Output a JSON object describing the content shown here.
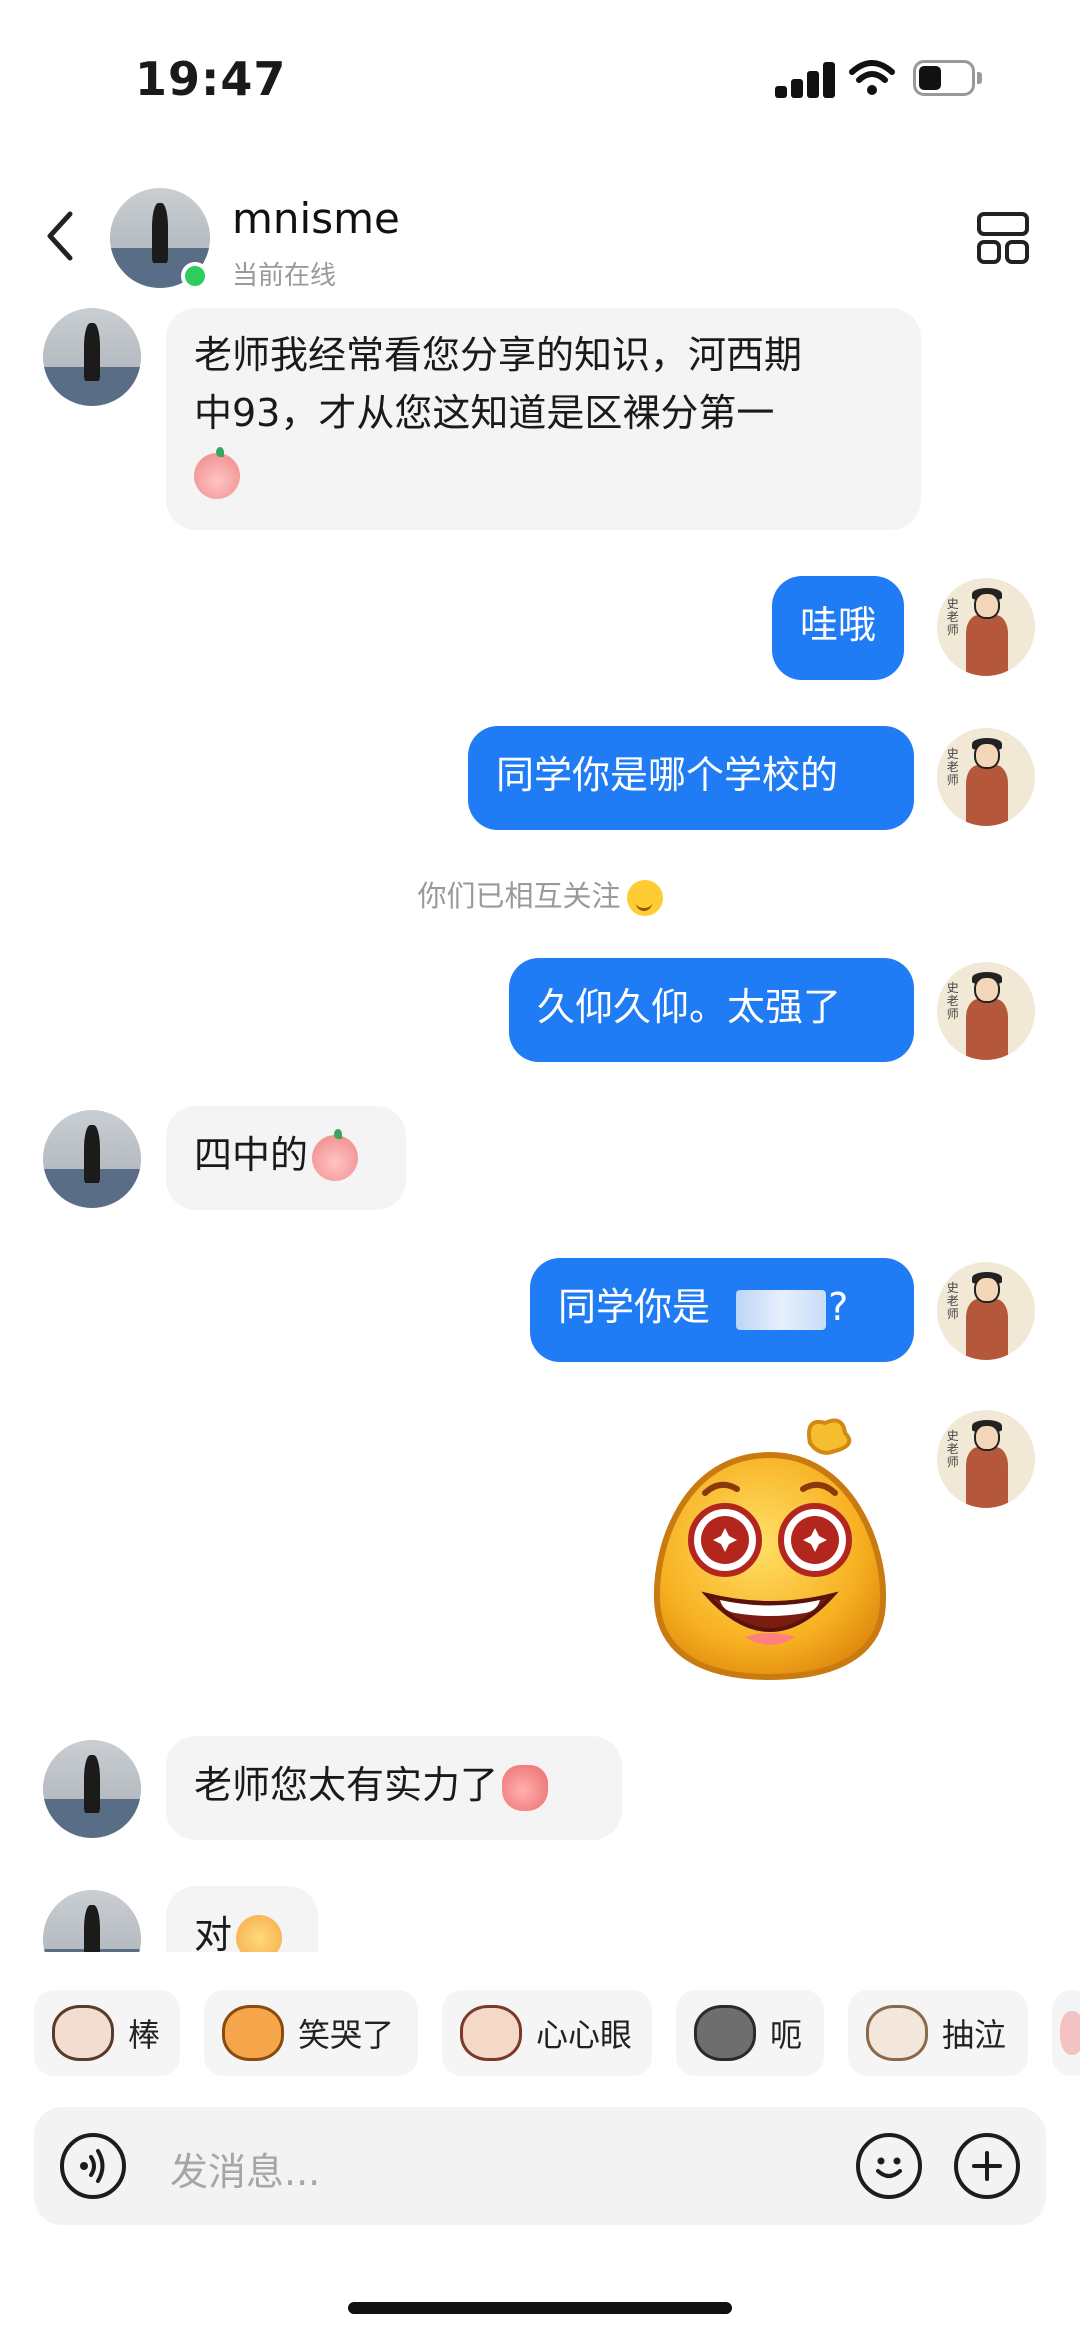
{
  "status_bar": {
    "time": "19:47"
  },
  "header": {
    "name": "mnisme",
    "status": "当前在线"
  },
  "messages": {
    "m1": {
      "line1": "老师我经常看您分享的知识，河西期",
      "line2": "中93，才从您这知道是区裸分第一"
    },
    "m2": "哇哦",
    "m3": "同学你是哪个学校的",
    "system_notice": "你们已相互关注",
    "m4": "久仰久仰。太强了",
    "m5": "四中的",
    "m6_prefix": "同学你是",
    "m6_suffix": "?",
    "m7": "老师您太有实力了",
    "m8": "对"
  },
  "quick_replies": [
    "棒",
    "笑哭了",
    "心心眼",
    "呃",
    "抽泣"
  ],
  "input": {
    "placeholder": "发消息..."
  },
  "colors": {
    "outgoing_bubble": "#1f7cf5",
    "incoming_bubble": "#f4f4f4",
    "online_dot": "#2ecc5a"
  },
  "icons": {
    "back": "chevron-left-icon",
    "menu": "grid-layout-icon",
    "voice": "voice-wave-icon",
    "emoji": "smiley-icon",
    "plus": "plus-icon"
  }
}
